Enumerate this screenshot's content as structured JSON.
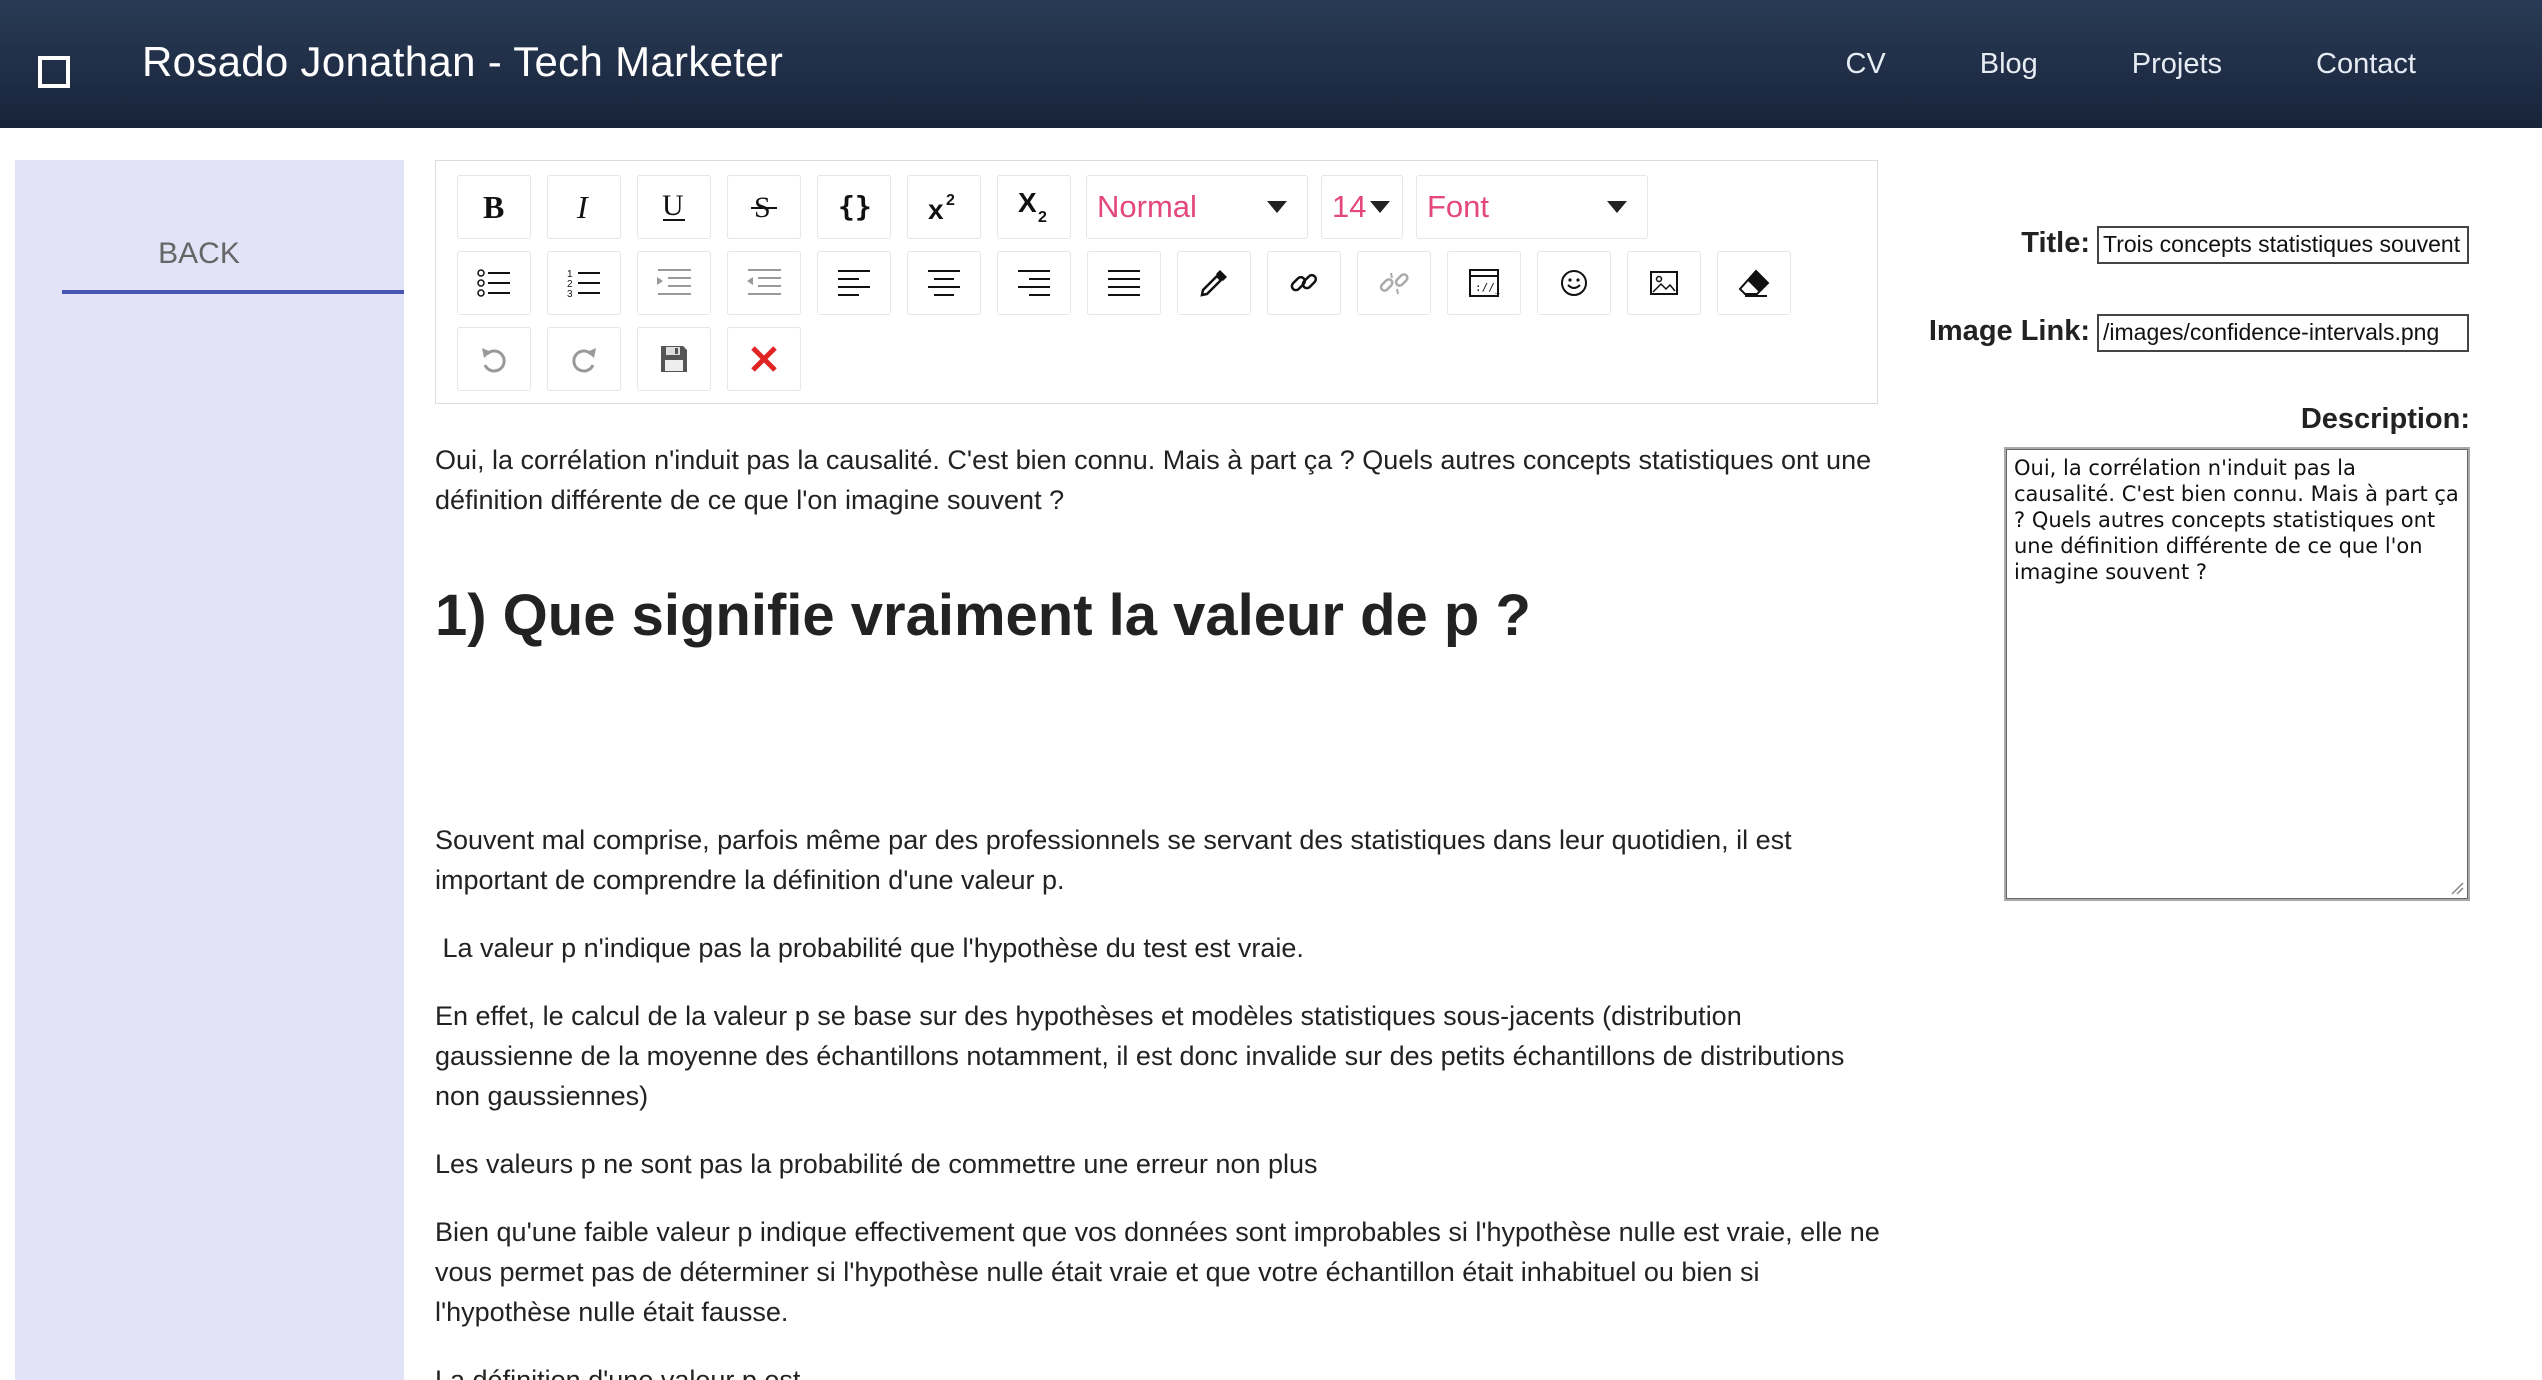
{
  "navbar": {
    "brand": "Rosado Jonathan - Tech Marketer",
    "links": [
      "CV",
      "Blog",
      "Projets",
      "Contact"
    ]
  },
  "sidebar": {
    "back_label": "BACK"
  },
  "toolbar": {
    "row1": [
      "bold-icon",
      "italic-icon",
      "underline-icon",
      "strikethrough-icon",
      "code-block-icon",
      "superscript-icon",
      "subscript-icon"
    ],
    "block_type": "Normal",
    "font_size": "14",
    "font_family": "Font",
    "row2": [
      "unordered-list-icon",
      "ordered-list-icon",
      "indent-icon",
      "outdent-icon",
      "align-left-icon",
      "align-center-icon",
      "align-right-icon",
      "align-justify-icon",
      "color-picker-icon",
      "link-icon",
      "unlink-icon",
      "embed-icon",
      "emoji-icon",
      "image-icon",
      "eraser-icon"
    ],
    "row3": [
      "undo-icon",
      "redo-icon",
      "save-icon",
      "close-icon"
    ],
    "accent_color": "#e3477d",
    "close_color": "#e02424"
  },
  "editor": {
    "intro": "Oui, la corrélation n'induit pas la causalité. C'est bien connu. Mais à part ça ? Quels autres concepts statistiques ont une définition différente de ce que l'on imagine souvent ?",
    "heading": "1) Que signifie vraiment la valeur de p ?",
    "p1": "Souvent mal comprise, parfois même par des professionnels se servant des statistiques dans leur quotidien, il est important de comprendre la définition d'une valeur p.",
    "p2": " La valeur p n'indique pas la probabilité que l'hypothèse du test est vraie.",
    "p3": "En effet, le calcul de la valeur p se base sur des hypothèses et modèles statistiques sous-jacents (distribution gaussienne de la moyenne des échantillons notamment, il est donc invalide sur des petits échantillons de distributions non gaussiennes)",
    "p4": "Les valeurs p ne sont pas la probabilité de commettre une erreur non plus",
    "p5": "Bien qu'une faible valeur p indique effectivement que vos données sont improbables si l'hypothèse nulle est vraie, elle ne vous permet pas de déterminer si l'hypothèse nulle était vraie et que votre échantillon était inhabituel ou bien si l'hypothèse nulle était fausse.",
    "p6": "La définition d'une valeur p est"
  },
  "form": {
    "title_label": "Title:",
    "title_value": "Trois concepts statistiques souvent",
    "image_label": "Image Link:",
    "image_value": "/images/confidence-intervals.png",
    "description_label": "Description:",
    "description_value": "Oui, la corrélation n'induit pas la causalité. C'est bien connu. Mais à part ça ? Quels autres concepts statistiques ont une définition différente de ce que l'on imagine souvent ?"
  }
}
